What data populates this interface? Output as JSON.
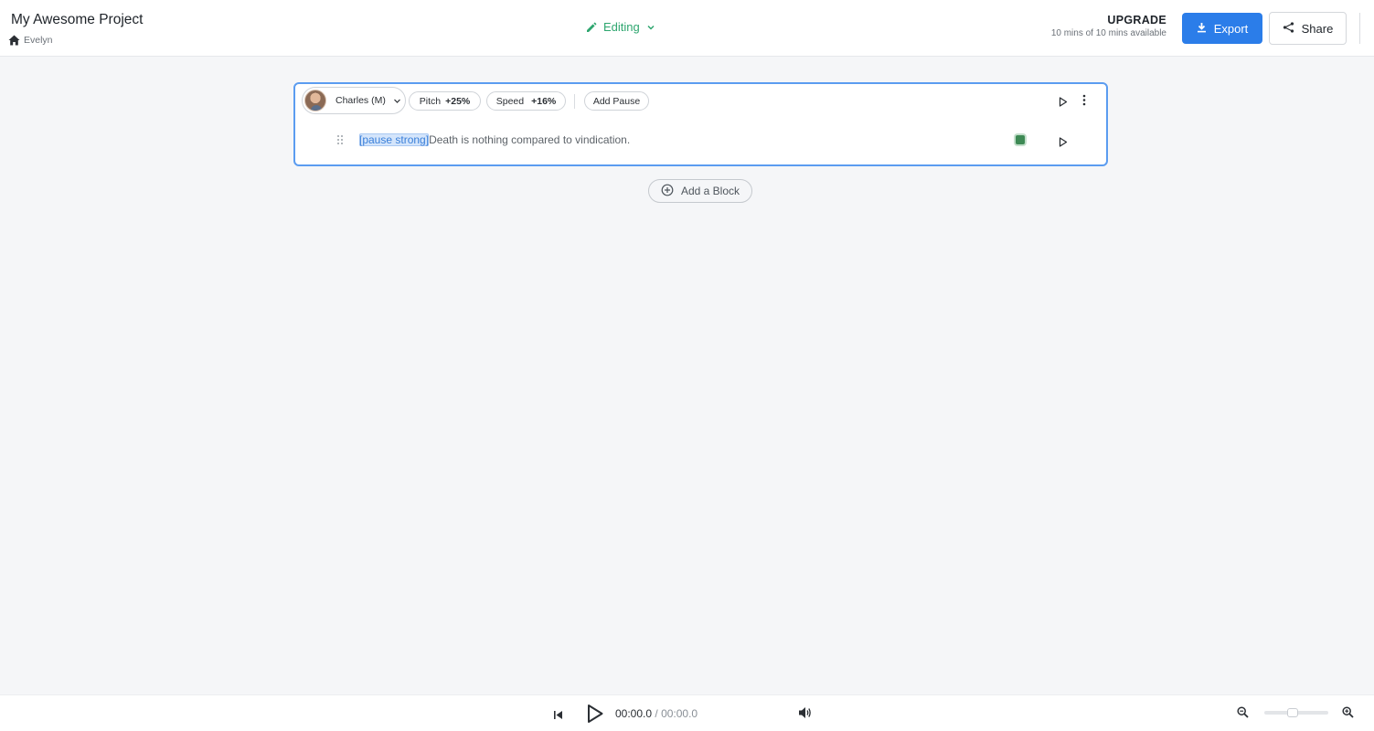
{
  "header": {
    "project_title": "My Awesome Project",
    "breadcrumb": "Evelyn",
    "mode_label": "Editing",
    "upgrade_label": "UPGRADE",
    "usage_text": "10 mins of 10 mins available",
    "export_label": "Export",
    "share_label": "Share"
  },
  "block": {
    "voice_name": "Charles (M)",
    "pitch_label": "Pitch",
    "pitch_value": "+25%",
    "speed_label": "Speed",
    "speed_value": "+16%",
    "add_pause_label": "Add Pause",
    "line": {
      "tag": "[pause strong]",
      "text": "Death is nothing compared to vindication."
    }
  },
  "add_block_label": "Add a Block",
  "player": {
    "current_time": "00:00.0",
    "separator": " / ",
    "duration": "00:00.0"
  },
  "colors": {
    "accent": "#2b7de9",
    "editing_green": "#2ea66f",
    "block_border": "#5b9cf0",
    "status_green": "#3e8a55"
  }
}
